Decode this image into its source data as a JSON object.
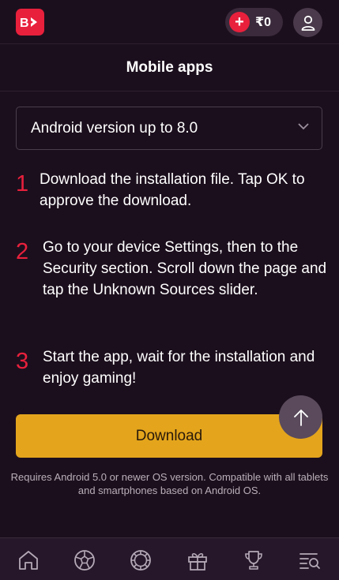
{
  "header": {
    "logo_text": "B>",
    "balance": "₹0"
  },
  "page": {
    "title": "Mobile apps"
  },
  "version_select": {
    "selected": "Android version up to 8.0"
  },
  "steps": [
    {
      "number": "1",
      "text": "Download the installation file. Tap OK to approve the download."
    },
    {
      "number": "2",
      "text": "Go to your device Settings, then to the Security section. Scroll down the page and tap the Unknown Sources slider."
    },
    {
      "number": "3",
      "text": "Start the app, wait for the installation and enjoy gaming!"
    }
  ],
  "download_label": "Download",
  "requirements_note": "Requires Android 5.0 or newer OS version. Compatible with all tablets and smartphones based on Android OS.",
  "colors": {
    "background": "#1c0f1d",
    "brand_red": "#e8203c",
    "download_yellow": "#e4a51c"
  },
  "bottom_nav": [
    {
      "icon": "home-icon"
    },
    {
      "icon": "soccer-ball-icon"
    },
    {
      "icon": "casino-chip-icon"
    },
    {
      "icon": "gift-icon"
    },
    {
      "icon": "trophy-icon"
    },
    {
      "icon": "menu-search-icon"
    }
  ]
}
